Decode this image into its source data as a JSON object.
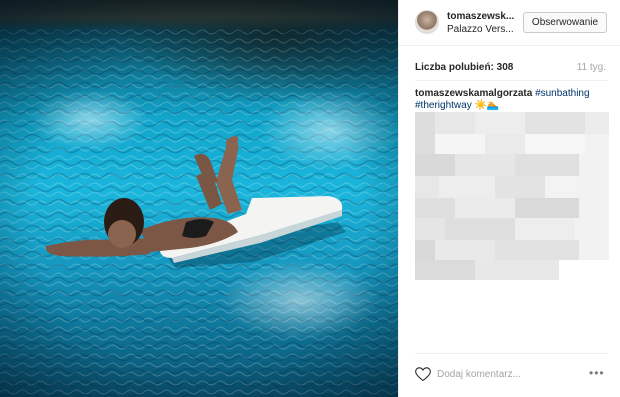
{
  "post": {
    "photo_alt": "",
    "author": {
      "username": "tomaszewsk...",
      "location": "Palazzo Vers..."
    },
    "follow_label": "Obserwowanie",
    "likes_text": "Liczba polubień: 308",
    "time_ago": "11 tyg.",
    "caption": {
      "username": "tomaszewskamalgorzata",
      "hashtag_1": "#sunbathing",
      "hashtag_2": "#therightway",
      "emoji": "☀️🏊"
    },
    "comment_placeholder": "Dodaj komentarz...",
    "more_label": "•••"
  },
  "colors": {
    "link": "#003569",
    "muted": "#a5a5a5",
    "border": "#efefef"
  }
}
